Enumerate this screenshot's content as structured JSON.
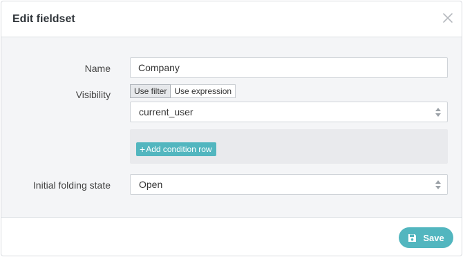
{
  "dialog": {
    "title": "Edit fieldset"
  },
  "form": {
    "name": {
      "label": "Name",
      "value": "Company"
    },
    "visibility": {
      "label": "Visibility",
      "modes": [
        "Use filter",
        "Use expression"
      ],
      "active_mode": "Use filter",
      "field_value": "current_user",
      "add_condition_label": "Add condition row"
    },
    "folding": {
      "label": "Initial folding state",
      "value": "Open"
    }
  },
  "footer": {
    "save_label": "Save"
  },
  "colors": {
    "accent": "#52b6bf",
    "background": "#f4f5f7",
    "border": "#cfd3d8"
  },
  "icons": {
    "close": "close-icon",
    "select": "updown-arrows-icon",
    "add": "plus-icon",
    "save": "floppy-disk-icon"
  }
}
